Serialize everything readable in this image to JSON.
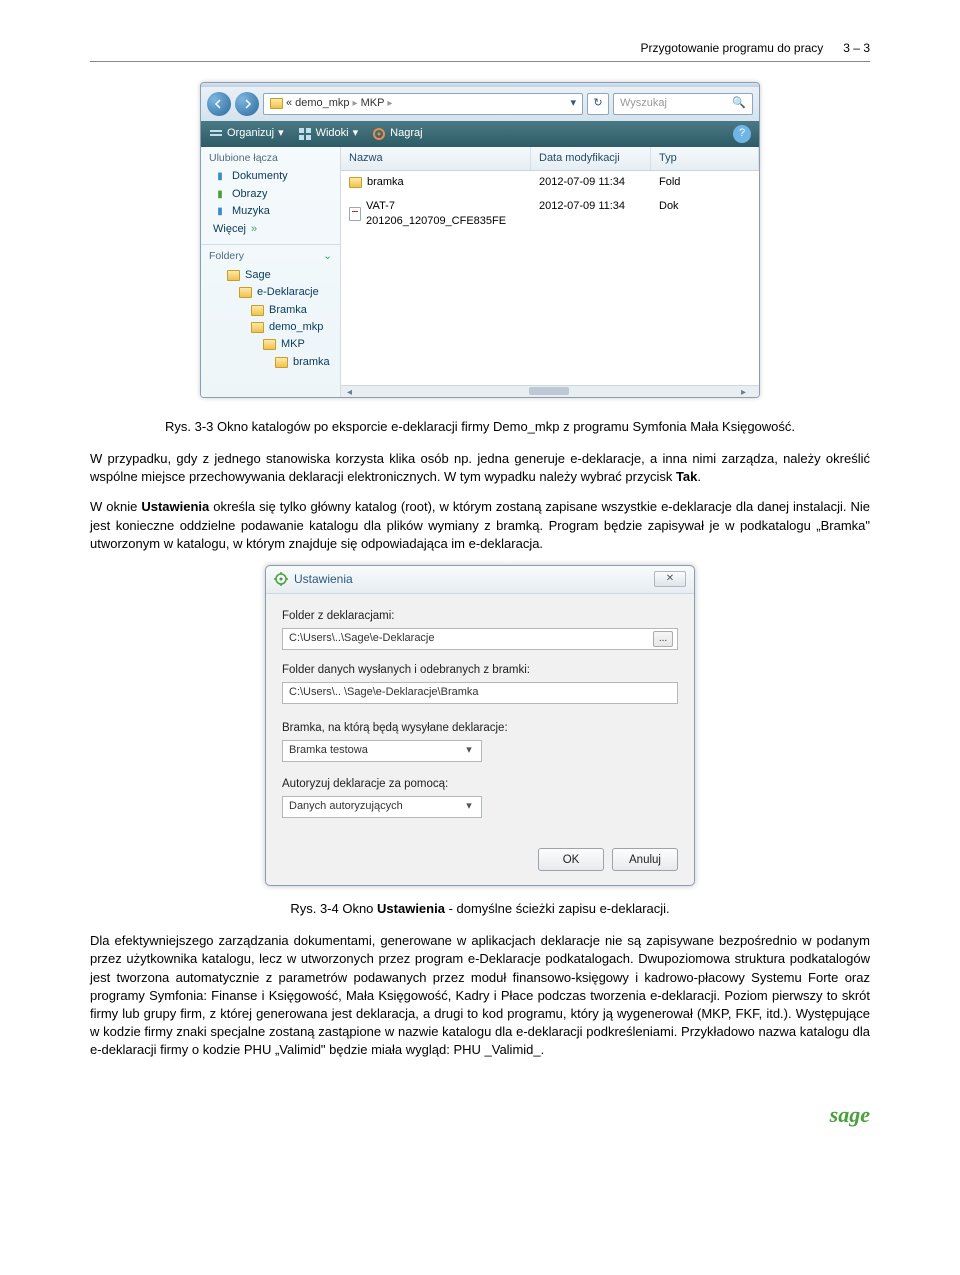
{
  "header": {
    "page_title": "Przygotowanie programu do pracy",
    "page_number": "3 – 3"
  },
  "explorer": {
    "path": {
      "root_marker": "«",
      "seg1": "demo_mkp",
      "seg2": "MKP"
    },
    "search_placeholder": "Wyszukaj",
    "toolbar": {
      "organize": "Organizuj",
      "views": "Widoki",
      "burn": "Nagraj"
    },
    "sidebar": {
      "fav_title": "Ulubione łącza",
      "documents": "Dokumenty",
      "pictures": "Obrazy",
      "music": "Muzyka",
      "more": "Więcej",
      "folders_title": "Foldery",
      "tree": {
        "n0": "Sage",
        "n1": "e-Deklaracje",
        "n2": "Bramka",
        "n3": "demo_mkp",
        "n4": "MKP",
        "n5": "bramka"
      }
    },
    "columns": {
      "name": "Nazwa",
      "date": "Data modyfikacji",
      "type": "Typ"
    },
    "rows": [
      {
        "name": "bramka",
        "date": "2012-07-09 11:34",
        "type": "Fold",
        "kind": "folder"
      },
      {
        "name": "VAT-7 201206_120709_CFE835FE",
        "date": "2012-07-09 11:34",
        "type": "Dok",
        "kind": "file"
      }
    ]
  },
  "caption1_prefix": "Rys. 3-3 Okno katalogów po eksporcie e-deklaracji firmy Demo_mkp z programu Symfonia Mała Księgowość.",
  "para1": "W przypadku, gdy z jednego stanowiska korzysta klika osób np. jedna generuje e-deklaracje, a inna nimi zarządza, należy określić wspólne miejsce przechowywania deklaracji elektronicznych. W tym wypadku należy wybrać przycisk ",
  "para1_b": "Tak",
  "para1_end": ".",
  "para2a": "W oknie ",
  "para2b": "Ustawienia",
  "para2c": " określa się tylko główny katalog (root), w którym zostaną zapisane wszystkie e-deklaracje dla danej instalacji. Nie jest konieczne oddzielne podawanie katalogu dla plików wymiany z bramką. Program będzie zapisywał je w podkatalogu „Bramka\" utworzonym w katalogu, w którym znajduje się odpowiadająca im e-deklaracja.",
  "settings": {
    "title": "Ustawienia",
    "folder_decl_label": "Folder z deklaracjami:",
    "folder_decl_value": "C:\\Users\\..\\Sage\\e-Deklaracje",
    "folder_bramka_label": "Folder danych wysłanych i odebranych z bramki:",
    "folder_bramka_value": "C:\\Users\\.. \\Sage\\e-Deklaracje\\Bramka",
    "bramka_label": "Bramka, na którą będą wysyłane deklaracje:",
    "bramka_value": "Bramka testowa",
    "auth_label": "Autoryzuj deklaracje za pomocą:",
    "auth_value": "Danych autoryzujących",
    "ok": "OK",
    "cancel": "Anuluj",
    "browse": "..."
  },
  "caption2a": "Rys. 3-4 Okno ",
  "caption2b": "Ustawienia",
  "caption2c": " - domyślne ścieżki zapisu e-deklaracji.",
  "para3": "Dla efektywniejszego zarządzania dokumentami, generowane w aplikacjach deklaracje nie są zapisywane bezpośrednio w podanym przez użytkownika katalogu, lecz w utworzonych przez program e-Deklaracje podkatalogach. Dwupoziomowa struktura podkatalogów jest tworzona automatycznie z parametrów podawanych przez moduł finansowo-księgowy i kadrowo-płacowy Systemu Forte oraz programy Symfonia: Finanse i Księgowość, Mała Księgowość, Kadry i Płace podczas tworzenia e-deklaracji. Poziom pierwszy to skrót firmy lub grupy firm, z której generowana jest deklaracja, a drugi to kod programu, który ją wygenerował (MKP, FKF, itd.). Występujące w kodzie firmy znaki specjalne zostaną zastąpione w nazwie katalogu dla e-deklaracji podkreśleniami. Przykładowo nazwa katalogu dla e-deklaracji firmy o kodzie PHU „Valimid\" będzie miała wygląd: PHU _Valimid_.",
  "footer_logo": "sage"
}
